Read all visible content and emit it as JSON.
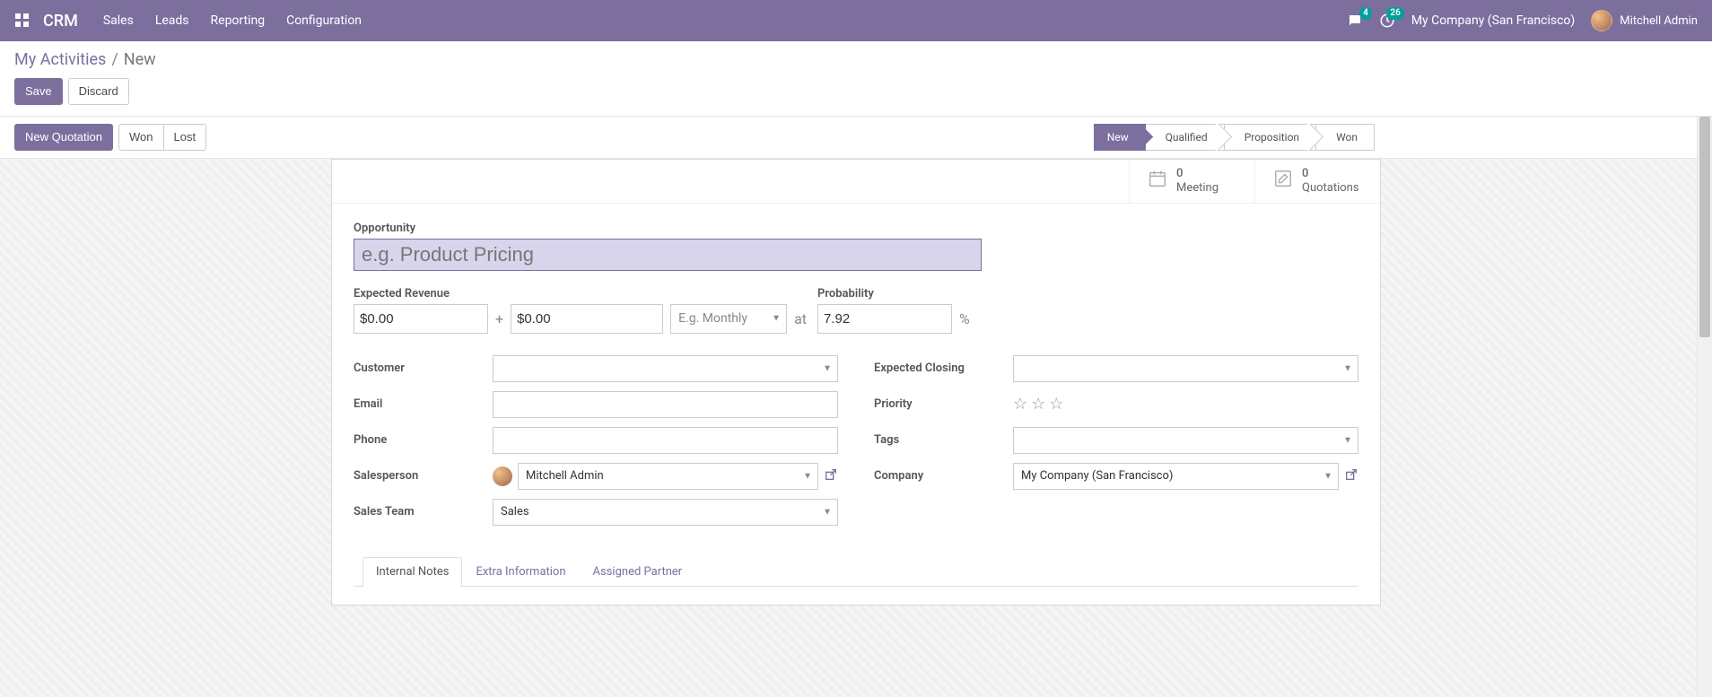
{
  "navbar": {
    "brand": "CRM",
    "menu": [
      "Sales",
      "Leads",
      "Reporting",
      "Configuration"
    ],
    "messages_badge": "4",
    "activities_badge": "26",
    "company": "My Company (San Francisco)",
    "user_name": "Mitchell Admin"
  },
  "breadcrumb": {
    "link": "My Activities",
    "current": "New"
  },
  "cp_buttons": {
    "save": "Save",
    "discard": "Discard"
  },
  "action_bar": {
    "new_quotation": "New Quotation",
    "won": "Won",
    "lost": "Lost"
  },
  "stages": {
    "new": "New",
    "qualified": "Qualified",
    "proposition": "Proposition",
    "won": "Won"
  },
  "stat_buttons": {
    "meeting_count": "0",
    "meeting_label": "Meeting",
    "quotations_count": "0",
    "quotations_label": "Quotations"
  },
  "fields": {
    "opportunity_label": "Opportunity",
    "opportunity_placeholder": "e.g. Product Pricing",
    "expected_revenue_label": "Expected Revenue",
    "revenue_value": "$0.00",
    "recurring_value": "$0.00",
    "recurring_plan_placeholder": "E.g. Monthly",
    "plus": "+",
    "at": "at",
    "percent": "%",
    "probability_label": "Probability",
    "probability_value": "7.92",
    "customer_label": "Customer",
    "email_label": "Email",
    "phone_label": "Phone",
    "salesperson_label": "Salesperson",
    "salesperson_value": "Mitchell Admin",
    "sales_team_label": "Sales Team",
    "sales_team_value": "Sales",
    "expected_closing_label": "Expected Closing",
    "priority_label": "Priority",
    "tags_label": "Tags",
    "company_label": "Company",
    "company_value": "My Company (San Francisco)"
  },
  "tabs": {
    "internal_notes": "Internal Notes",
    "extra_info": "Extra Information",
    "assigned_partner": "Assigned Partner"
  }
}
